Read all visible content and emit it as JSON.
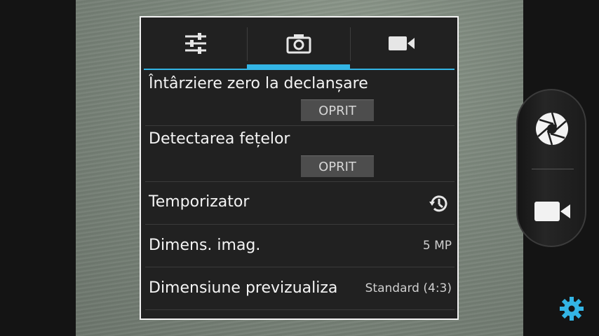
{
  "tabs": [
    {
      "icon": "sliders-icon"
    },
    {
      "icon": "camera-icon",
      "selected": true
    },
    {
      "icon": "video-camera-icon"
    }
  ],
  "settings": {
    "zero_shutter_lag": {
      "label": "Întârziere zero la declanșare",
      "value": "OPRIT"
    },
    "face_detection": {
      "label": "Detectarea fețelor",
      "value": "OPRIT"
    },
    "timer": {
      "label": "Temporizator",
      "icon": "timer-icon"
    },
    "image_size": {
      "label": "Dimens. imag.",
      "value": "5 MP"
    },
    "preview_size": {
      "label": "Dimensiune previzualiza",
      "value": "Standard (4:3)"
    }
  },
  "controls": {
    "shutter_icon": "shutter-icon",
    "video_icon": "video-camera-icon",
    "settings_icon": "gear-icon"
  },
  "colors": {
    "accent": "#33b5e5",
    "panel_bg": "#212121",
    "panel_border": "#f2f2f2"
  }
}
